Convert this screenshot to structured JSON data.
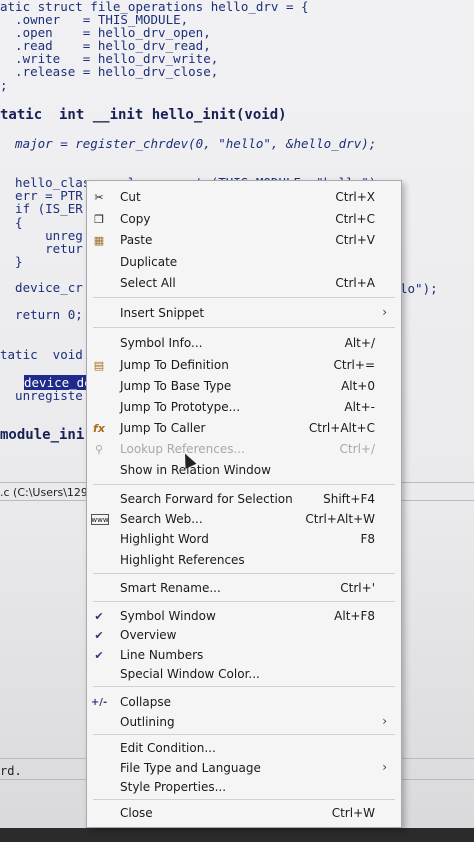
{
  "editor": {
    "lines": [
      {
        "text": "atic struct file_operations hello_drv = {"
      },
      {
        "text": "  .owner   = THIS_MODULE,"
      },
      {
        "text": "  .open    = hello_drv_open,"
      },
      {
        "text": "  .read    = hello_drv_read,"
      },
      {
        "text": "  .write   = hello_drv_write,"
      },
      {
        "text": "  .release = hello_drv_close,"
      },
      {
        "text": ";"
      },
      {
        "text": "tatic  int __init hello_init(void)"
      },
      {
        "text": "  major = register_chrdev(0, \"hello\", &hello_drv);"
      },
      {
        "text": "  hello_class = class_create(THIS_MODULE, \"hello\");"
      },
      {
        "text": "  err = PTR"
      },
      {
        "text": "  if (IS_ER"
      },
      {
        "text": "  {"
      },
      {
        "text": "      unreg"
      },
      {
        "text": "      retur"
      },
      {
        "text": "  }"
      },
      {
        "text": "  device_cr"
      },
      {
        "text": "lo\");"
      },
      {
        "text": "  return 0;"
      },
      {
        "text": "tatic  void"
      },
      {
        "text": "device_de"
      },
      {
        "text": "  unregiste"
      },
      {
        "text": "module_ini"
      }
    ],
    "status_path": ".c (C:\\Users\\1299",
    "status_word": "rd."
  },
  "menu": {
    "items": [
      {
        "label": "Cut",
        "shortcut": "Ctrl+X",
        "icon": "scissors-icon"
      },
      {
        "label": "Copy",
        "shortcut": "Ctrl+C",
        "icon": "copy-icon"
      },
      {
        "label": "Paste",
        "shortcut": "Ctrl+V",
        "icon": "paste-icon"
      },
      {
        "label": "Duplicate",
        "shortcut": ""
      },
      {
        "label": "Select All",
        "shortcut": "Ctrl+A"
      },
      {
        "label": "Insert Snippet",
        "shortcut": "",
        "submenu": true
      },
      {
        "label": "Symbol Info...",
        "shortcut": "Alt+/"
      },
      {
        "label": "Jump To Definition",
        "shortcut": "Ctrl+=",
        "icon": "jump-definition-icon"
      },
      {
        "label": "Jump To Base Type",
        "shortcut": "Alt+0"
      },
      {
        "label": "Jump To Prototype...",
        "shortcut": "Alt+-"
      },
      {
        "label": "Jump To Caller",
        "shortcut": "Ctrl+Alt+C",
        "icon": "jump-caller-icon"
      },
      {
        "label": "Lookup References...",
        "shortcut": "Ctrl+/",
        "disabled": true,
        "icon": "lookup-references-icon"
      },
      {
        "label": "Show in Relation Window",
        "shortcut": ""
      },
      {
        "label": "Search Forward for Selection",
        "shortcut": "Shift+F4"
      },
      {
        "label": "Search Web...",
        "shortcut": "Ctrl+Alt+W",
        "icon": "search-web-icon"
      },
      {
        "label": "Highlight Word",
        "shortcut": "F8"
      },
      {
        "label": "Highlight References",
        "shortcut": ""
      },
      {
        "label": "Smart Rename...",
        "shortcut": "Ctrl+'"
      },
      {
        "label": "Symbol Window",
        "shortcut": "Alt+F8",
        "checked": true
      },
      {
        "label": "Overview",
        "shortcut": "",
        "checked": true
      },
      {
        "label": "Line Numbers",
        "shortcut": "",
        "checked": true
      },
      {
        "label": "Special Window Color...",
        "shortcut": ""
      },
      {
        "label": "Collapse",
        "shortcut": "",
        "icon": "collapse-icon"
      },
      {
        "label": "Outlining",
        "shortcut": "",
        "submenu": true
      },
      {
        "label": "Edit Condition...",
        "shortcut": ""
      },
      {
        "label": "File Type and Language",
        "shortcut": "",
        "submenu": true
      },
      {
        "label": "Style Properties...",
        "shortcut": ""
      },
      {
        "label": "Close",
        "shortcut": "Ctrl+W"
      }
    ]
  },
  "colors": {
    "menu_bg": "#f5f5f6",
    "code_blue": "#1c2f7a",
    "selection": "#1f2a8a",
    "disabled": "#a8a8ac"
  }
}
